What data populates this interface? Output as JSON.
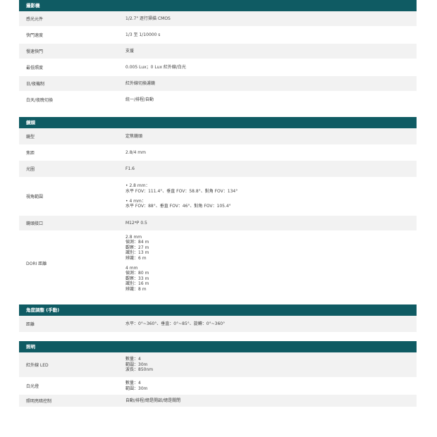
{
  "colors": {
    "header_bg": "#0f5b63",
    "row_alt": "#f2f2f2"
  },
  "sections": [
    {
      "title": "攝影機",
      "rows": [
        {
          "label": "感光元件",
          "blocks": [
            [
              "1/2.7\" 逐行掃描 CMOS"
            ]
          ]
        },
        {
          "label": "快門速度",
          "blocks": [
            [
              "1/3 至 1/10000 s"
            ]
          ]
        },
        {
          "label": "慢速快門",
          "blocks": [
            [
              "支援"
            ]
          ]
        },
        {
          "label": "最低照度",
          "blocks": [
            [
              "0.005 Lux；0 Lux 紅外線/白光"
            ]
          ]
        },
        {
          "label": "日/夜機制",
          "blocks": [
            [
              "紅外線切換濾鏡"
            ]
          ]
        },
        {
          "label": "白天/夜晚切換",
          "blocks": [
            [
              "統一/排程/自動"
            ]
          ]
        }
      ]
    },
    {
      "title": "鏡頭",
      "rows": [
        {
          "label": "鏡型",
          "blocks": [
            [
              "定焦鏡頭"
            ]
          ]
        },
        {
          "label": "焦距",
          "blocks": [
            [
              "2.8/4 mm"
            ]
          ]
        },
        {
          "label": "光圈",
          "blocks": [
            [
              "F1.6"
            ]
          ]
        },
        {
          "label": "視角範圍",
          "blocks": [
            [
              "• 2.8 mm：",
              "水平 FOV：111.4°、垂直 FOV：58.8°、對角 FOV：134°"
            ],
            [
              "• 4 mm：",
              "水平 FOV：88°、垂直 FOV：46°、對角 FOV：105.4°"
            ]
          ]
        },
        {
          "label": "鏡頭接口",
          "blocks": [
            [
              "M12*P 0.5"
            ]
          ]
        },
        {
          "label": "DORI 距離",
          "blocks": [
            [
              "2.8 mm",
              "偵測：84 m",
              "觀察：27 m",
              "識別：13 m",
              "辨識：6 m"
            ],
            [
              "4 mm",
              "偵測：80 m",
              "觀察：33 m",
              "識別：16 m",
              "辨識：8 m"
            ]
          ]
        }
      ]
    },
    {
      "title": "角度調整 (手動)",
      "rows": [
        {
          "label": "距離",
          "blocks": [
            [
              "水平：0°~360°、垂直：0°~85°、旋轉：0°~360°"
            ]
          ]
        }
      ]
    },
    {
      "title": "照明",
      "rows": [
        {
          "label": "紅外線 LED",
          "blocks": [
            [
              "數量：4",
              "範圍：30m",
              "波長：850nm"
            ]
          ]
        },
        {
          "label": "白光燈",
          "blocks": [
            [
              "數量：4",
              "範圍：30m"
            ]
          ]
        },
        {
          "label": "照明亮暗控制",
          "blocks": [
            [
              "自動/排程/總是開啟/總是關閉"
            ]
          ]
        }
      ]
    }
  ]
}
